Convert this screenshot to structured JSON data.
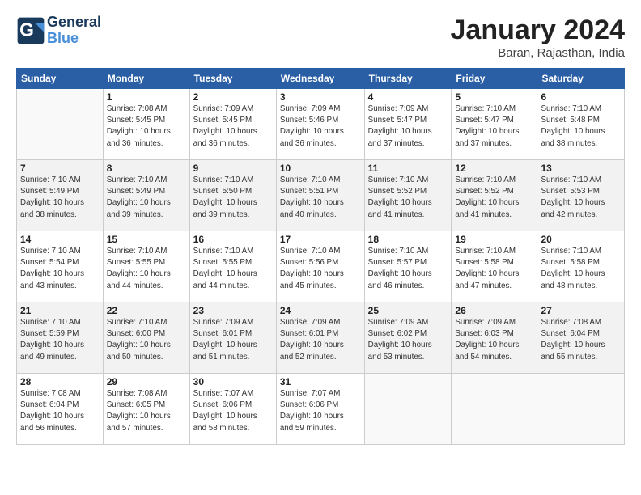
{
  "header": {
    "logo_line1": "General",
    "logo_line2": "Blue",
    "month": "January 2024",
    "location": "Baran, Rajasthan, India"
  },
  "weekdays": [
    "Sunday",
    "Monday",
    "Tuesday",
    "Wednesday",
    "Thursday",
    "Friday",
    "Saturday"
  ],
  "weeks": [
    [
      {
        "day": "",
        "info": ""
      },
      {
        "day": "1",
        "info": "Sunrise: 7:08 AM\nSunset: 5:45 PM\nDaylight: 10 hours\nand 36 minutes."
      },
      {
        "day": "2",
        "info": "Sunrise: 7:09 AM\nSunset: 5:45 PM\nDaylight: 10 hours\nand 36 minutes."
      },
      {
        "day": "3",
        "info": "Sunrise: 7:09 AM\nSunset: 5:46 PM\nDaylight: 10 hours\nand 36 minutes."
      },
      {
        "day": "4",
        "info": "Sunrise: 7:09 AM\nSunset: 5:47 PM\nDaylight: 10 hours\nand 37 minutes."
      },
      {
        "day": "5",
        "info": "Sunrise: 7:10 AM\nSunset: 5:47 PM\nDaylight: 10 hours\nand 37 minutes."
      },
      {
        "day": "6",
        "info": "Sunrise: 7:10 AM\nSunset: 5:48 PM\nDaylight: 10 hours\nand 38 minutes."
      }
    ],
    [
      {
        "day": "7",
        "info": "Sunrise: 7:10 AM\nSunset: 5:49 PM\nDaylight: 10 hours\nand 38 minutes."
      },
      {
        "day": "8",
        "info": "Sunrise: 7:10 AM\nSunset: 5:49 PM\nDaylight: 10 hours\nand 39 minutes."
      },
      {
        "day": "9",
        "info": "Sunrise: 7:10 AM\nSunset: 5:50 PM\nDaylight: 10 hours\nand 39 minutes."
      },
      {
        "day": "10",
        "info": "Sunrise: 7:10 AM\nSunset: 5:51 PM\nDaylight: 10 hours\nand 40 minutes."
      },
      {
        "day": "11",
        "info": "Sunrise: 7:10 AM\nSunset: 5:52 PM\nDaylight: 10 hours\nand 41 minutes."
      },
      {
        "day": "12",
        "info": "Sunrise: 7:10 AM\nSunset: 5:52 PM\nDaylight: 10 hours\nand 41 minutes."
      },
      {
        "day": "13",
        "info": "Sunrise: 7:10 AM\nSunset: 5:53 PM\nDaylight: 10 hours\nand 42 minutes."
      }
    ],
    [
      {
        "day": "14",
        "info": "Sunrise: 7:10 AM\nSunset: 5:54 PM\nDaylight: 10 hours\nand 43 minutes."
      },
      {
        "day": "15",
        "info": "Sunrise: 7:10 AM\nSunset: 5:55 PM\nDaylight: 10 hours\nand 44 minutes."
      },
      {
        "day": "16",
        "info": "Sunrise: 7:10 AM\nSunset: 5:55 PM\nDaylight: 10 hours\nand 44 minutes."
      },
      {
        "day": "17",
        "info": "Sunrise: 7:10 AM\nSunset: 5:56 PM\nDaylight: 10 hours\nand 45 minutes."
      },
      {
        "day": "18",
        "info": "Sunrise: 7:10 AM\nSunset: 5:57 PM\nDaylight: 10 hours\nand 46 minutes."
      },
      {
        "day": "19",
        "info": "Sunrise: 7:10 AM\nSunset: 5:58 PM\nDaylight: 10 hours\nand 47 minutes."
      },
      {
        "day": "20",
        "info": "Sunrise: 7:10 AM\nSunset: 5:58 PM\nDaylight: 10 hours\nand 48 minutes."
      }
    ],
    [
      {
        "day": "21",
        "info": "Sunrise: 7:10 AM\nSunset: 5:59 PM\nDaylight: 10 hours\nand 49 minutes."
      },
      {
        "day": "22",
        "info": "Sunrise: 7:10 AM\nSunset: 6:00 PM\nDaylight: 10 hours\nand 50 minutes."
      },
      {
        "day": "23",
        "info": "Sunrise: 7:09 AM\nSunset: 6:01 PM\nDaylight: 10 hours\nand 51 minutes."
      },
      {
        "day": "24",
        "info": "Sunrise: 7:09 AM\nSunset: 6:01 PM\nDaylight: 10 hours\nand 52 minutes."
      },
      {
        "day": "25",
        "info": "Sunrise: 7:09 AM\nSunset: 6:02 PM\nDaylight: 10 hours\nand 53 minutes."
      },
      {
        "day": "26",
        "info": "Sunrise: 7:09 AM\nSunset: 6:03 PM\nDaylight: 10 hours\nand 54 minutes."
      },
      {
        "day": "27",
        "info": "Sunrise: 7:08 AM\nSunset: 6:04 PM\nDaylight: 10 hours\nand 55 minutes."
      }
    ],
    [
      {
        "day": "28",
        "info": "Sunrise: 7:08 AM\nSunset: 6:04 PM\nDaylight: 10 hours\nand 56 minutes."
      },
      {
        "day": "29",
        "info": "Sunrise: 7:08 AM\nSunset: 6:05 PM\nDaylight: 10 hours\nand 57 minutes."
      },
      {
        "day": "30",
        "info": "Sunrise: 7:07 AM\nSunset: 6:06 PM\nDaylight: 10 hours\nand 58 minutes."
      },
      {
        "day": "31",
        "info": "Sunrise: 7:07 AM\nSunset: 6:06 PM\nDaylight: 10 hours\nand 59 minutes."
      },
      {
        "day": "",
        "info": ""
      },
      {
        "day": "",
        "info": ""
      },
      {
        "day": "",
        "info": ""
      }
    ]
  ]
}
